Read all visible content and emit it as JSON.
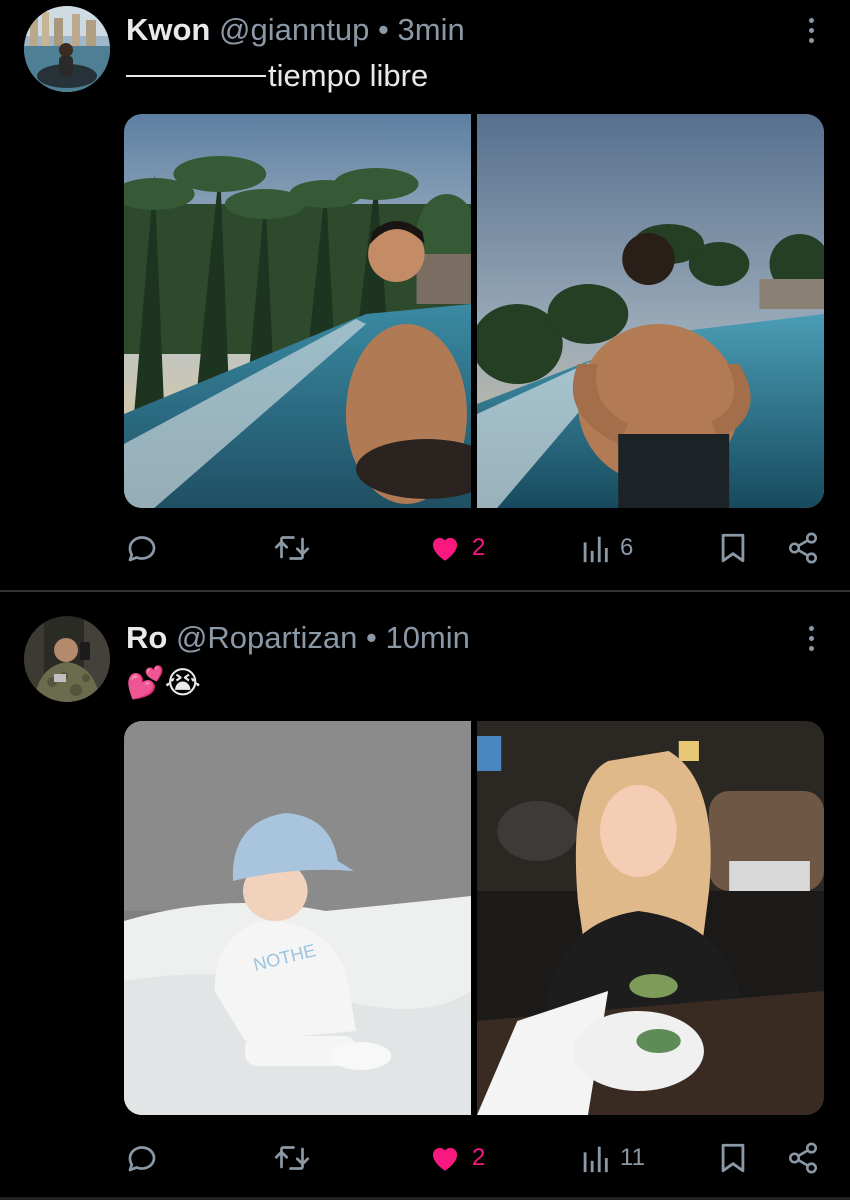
{
  "posts": [
    {
      "name": "Kwon",
      "handle": "@gianntup",
      "separator": "•",
      "time": "3min",
      "text": "tiempo libre",
      "actions": {
        "likes": "2",
        "views": "6"
      },
      "colors": {
        "like": "#f91880",
        "muted": "#8b98a5"
      },
      "icons": [
        "reply-icon",
        "retweet-icon",
        "heart-icon",
        "views-icon",
        "bookmark-icon",
        "share-icon"
      ]
    },
    {
      "name": "Ro",
      "handle": "@Ropartizan",
      "separator": "•",
      "time": "10min",
      "emoji": "💕😭",
      "actions": {
        "likes": "2",
        "views": "11"
      },
      "colors": {
        "like": "#f91880",
        "muted": "#8b98a5"
      },
      "icons": [
        "reply-icon",
        "retweet-icon",
        "heart-icon",
        "views-icon",
        "bookmark-icon",
        "share-icon"
      ]
    }
  ]
}
